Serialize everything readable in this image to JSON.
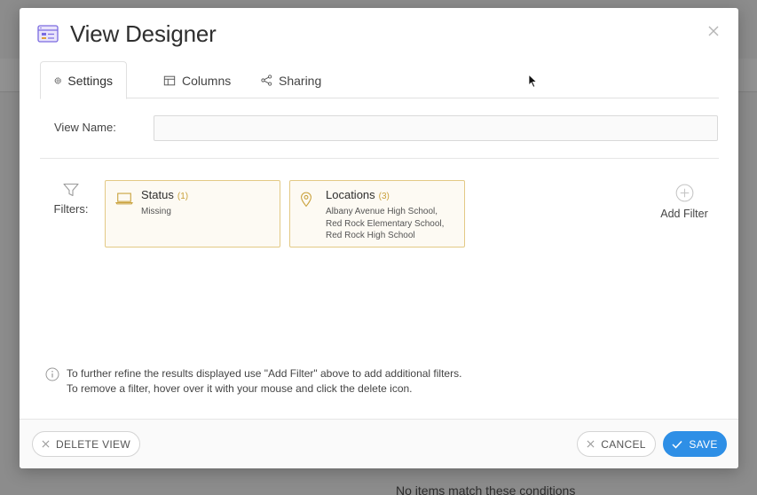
{
  "background": {
    "empty_message": "No items match these conditions"
  },
  "dialog": {
    "title": "View Designer",
    "tabs": [
      {
        "label": "Settings",
        "icon": "gear-icon",
        "active": true
      },
      {
        "label": "Columns",
        "icon": "table-columns-icon",
        "active": false
      },
      {
        "label": "Sharing",
        "icon": "share-icon",
        "active": false
      }
    ],
    "view_name": {
      "label": "View Name:",
      "value": "",
      "placeholder": ""
    },
    "filters": {
      "label": "Filters:",
      "items": [
        {
          "title": "Status",
          "count": "(1)",
          "icon": "laptop-icon",
          "description": "Missing"
        },
        {
          "title": "Locations",
          "count": "(3)",
          "icon": "map-pin-icon",
          "description": "Albany Avenue High School, Red Rock Elementary School, Red Rock High School"
        }
      ],
      "add_filter_label": "Add Filter"
    },
    "info": {
      "line1": "To further refine the results displayed use \"Add Filter\" above to add additional filters.",
      "line2": "To remove a filter, hover over it with your mouse and click the delete icon."
    },
    "footer": {
      "delete_label": "DELETE VIEW",
      "cancel_label": "CANCEL",
      "save_label": "SAVE"
    }
  },
  "colors": {
    "accent": "#2e8fe6",
    "filter_border": "#e3c985",
    "filter_bg": "#fdfaf3",
    "filter_count": "#c9a13b",
    "overlay": "#8c8c8c"
  }
}
